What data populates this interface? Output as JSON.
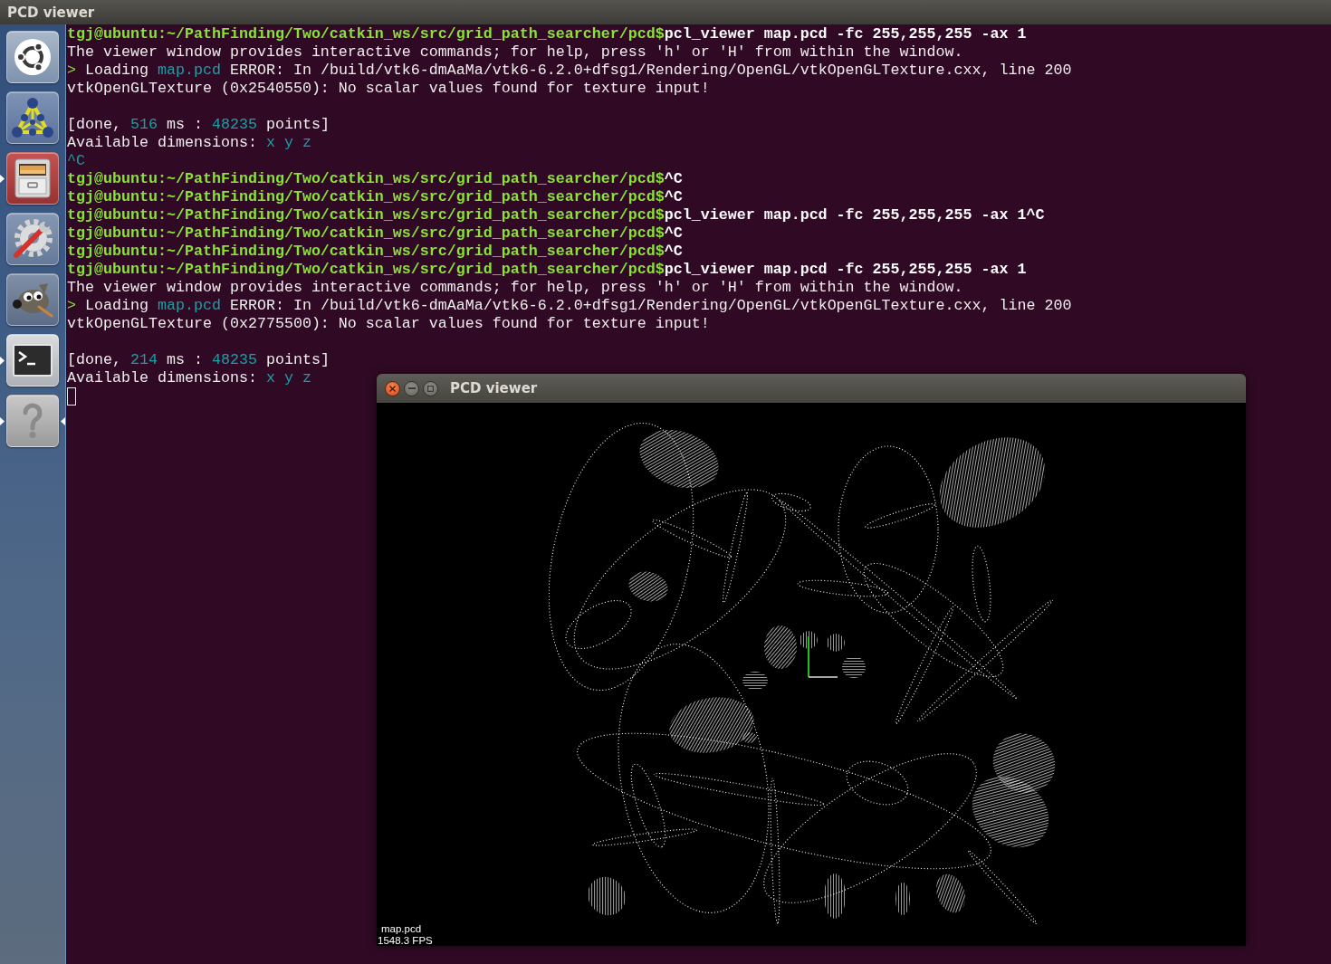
{
  "top_panel": {
    "title": "PCD viewer"
  },
  "launcher": {
    "items": [
      {
        "kind": "dash",
        "running": false,
        "focused": false
      },
      {
        "kind": "nodes",
        "running": false,
        "focused": false
      },
      {
        "kind": "files",
        "running": true,
        "focused": false
      },
      {
        "kind": "settings",
        "running": false,
        "focused": false
      },
      {
        "kind": "paint",
        "running": false,
        "focused": false
      },
      {
        "kind": "terminal",
        "running": true,
        "focused": false
      },
      {
        "kind": "unknown",
        "running": true,
        "focused": true
      }
    ]
  },
  "terminal": {
    "blocks": [
      {
        "lines": [
          {
            "segments": [
              {
                "kind": "prompt",
                "text": "tgj@ubuntu:~/PathFinding/Two/catkin_ws/src/grid_path_searcher/pcd$"
              },
              {
                "kind": "command",
                "text": "pcl_viewer map.pcd -fc 255,255,255 -ax 1"
              }
            ]
          },
          {
            "segments": [
              {
                "kind": "text",
                "text": "The viewer window provides interactive commands; for help, press 'h' or 'H' from within the window."
              }
            ]
          },
          {
            "segments": [
              {
                "kind": "marker",
                "text": ">"
              },
              {
                "kind": "text",
                "text": " Loading "
              },
              {
                "kind": "value",
                "text": "map.pcd"
              },
              {
                "kind": "text",
                "text": " ERROR: In /build/vtk6-dmAaMa/vtk6-6.2.0+dfsg1/Rendering/OpenGL/vtkOpenGLTexture.cxx, line 200"
              }
            ]
          },
          {
            "segments": [
              {
                "kind": "text",
                "text": "vtkOpenGLTexture (0x2540550): No scalar values found for texture input!"
              }
            ]
          }
        ]
      },
      {
        "lines": [
          {
            "segments": [
              {
                "kind": "text",
                "text": "[done, "
              },
              {
                "kind": "value",
                "text": "516"
              },
              {
                "kind": "text",
                "text": " ms : "
              },
              {
                "kind": "value",
                "text": "48235"
              },
              {
                "kind": "text",
                "text": " points]"
              }
            ]
          },
          {
            "segments": [
              {
                "kind": "text",
                "text": "Available dimensions: "
              },
              {
                "kind": "value",
                "text": "x y z"
              }
            ]
          },
          {
            "segments": [
              {
                "kind": "value",
                "text": "^C"
              }
            ]
          },
          {
            "segments": [
              {
                "kind": "prompt",
                "text": "tgj@ubuntu:~/PathFinding/Two/catkin_ws/src/grid_path_searcher/pcd$"
              },
              {
                "kind": "command",
                "text": "^C"
              }
            ]
          },
          {
            "segments": [
              {
                "kind": "prompt",
                "text": "tgj@ubuntu:~/PathFinding/Two/catkin_ws/src/grid_path_searcher/pcd$"
              },
              {
                "kind": "command",
                "text": "^C"
              }
            ]
          },
          {
            "segments": [
              {
                "kind": "prompt",
                "text": "tgj@ubuntu:~/PathFinding/Two/catkin_ws/src/grid_path_searcher/pcd$"
              },
              {
                "kind": "command",
                "text": "pcl_viewer map.pcd -fc 255,255,255 -ax 1^C"
              }
            ]
          },
          {
            "segments": [
              {
                "kind": "prompt",
                "text": "tgj@ubuntu:~/PathFinding/Two/catkin_ws/src/grid_path_searcher/pcd$"
              },
              {
                "kind": "command",
                "text": "^C"
              }
            ]
          },
          {
            "segments": [
              {
                "kind": "prompt",
                "text": "tgj@ubuntu:~/PathFinding/Two/catkin_ws/src/grid_path_searcher/pcd$"
              },
              {
                "kind": "command",
                "text": "^C"
              }
            ]
          },
          {
            "segments": [
              {
                "kind": "prompt",
                "text": "tgj@ubuntu:~/PathFinding/Two/catkin_ws/src/grid_path_searcher/pcd$"
              },
              {
                "kind": "command",
                "text": "pcl_viewer map.pcd -fc 255,255,255 -ax 1"
              }
            ]
          },
          {
            "segments": [
              {
                "kind": "text",
                "text": "The viewer window provides interactive commands; for help, press 'h' or 'H' from within the window."
              }
            ]
          },
          {
            "segments": [
              {
                "kind": "marker",
                "text": ">"
              },
              {
                "kind": "text",
                "text": " Loading "
              },
              {
                "kind": "value",
                "text": "map.pcd"
              },
              {
                "kind": "text",
                "text": " ERROR: In /build/vtk6-dmAaMa/vtk6-6.2.0+dfsg1/Rendering/OpenGL/vtkOpenGLTexture.cxx, line 200"
              }
            ]
          },
          {
            "segments": [
              {
                "kind": "text",
                "text": "vtkOpenGLTexture (0x2775500): No scalar values found for texture input!"
              }
            ]
          }
        ]
      },
      {
        "lines": [
          {
            "segments": [
              {
                "kind": "text",
                "text": "[done, "
              },
              {
                "kind": "value",
                "text": "214"
              },
              {
                "kind": "text",
                "text": " ms : "
              },
              {
                "kind": "value",
                "text": "48235"
              },
              {
                "kind": "text",
                "text": " points]"
              }
            ]
          },
          {
            "segments": [
              {
                "kind": "text",
                "text": "Available dimensions: "
              },
              {
                "kind": "value",
                "text": "x y z"
              }
            ]
          }
        ]
      }
    ],
    "cursor": true
  },
  "viewer": {
    "title": "PCD viewer",
    "buttons": [
      {
        "kind": "close"
      },
      {
        "kind": "minimize"
      },
      {
        "kind": "maximize"
      }
    ],
    "cloud_label": "map.pcd",
    "fps": "1548.3 FPS"
  }
}
